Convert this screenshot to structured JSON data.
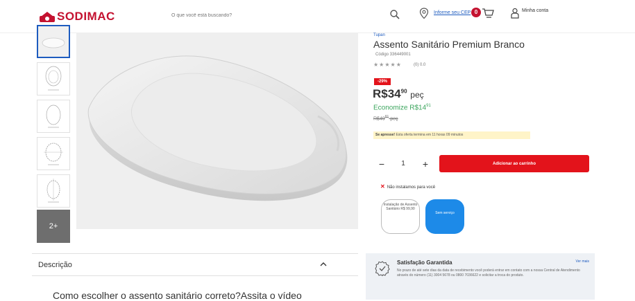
{
  "header": {
    "brand": "SODIMAC",
    "search_placeholder": "O que você está buscando?",
    "cep_link": "Informe seu CEP",
    "cart_count": "0",
    "account_label": "Minha conta"
  },
  "gallery": {
    "more_label": "2+"
  },
  "description": {
    "label": "Descrição",
    "body": "Como escolher o assento sanitário correto?Assita o vídeo"
  },
  "product": {
    "brand": "Tupan",
    "title": "Assento Sanitário Premium Branco",
    "code": "Código 336449001",
    "stars": "★★★★★",
    "rating": "(0) 0.0",
    "discount_badge": "-29%",
    "price": "R$34",
    "price_cents": "90",
    "price_unit": "peç",
    "savings": "Economize R$14",
    "savings_cents": "91",
    "old_price": "R$49",
    "old_price_cents": "81",
    "old_price_unit": "peç",
    "promo_label": "Se apresse!",
    "promo_text": "Esta oferta termina em 11 horas 09 minutos",
    "qty_minus": "−",
    "qty_value": "1",
    "qty_plus": "+",
    "add_to_cart": "Adicionar ao carrinho",
    "no_install": "Não instalamos para você",
    "option_install": "Instalação de Assento Sanitário R$ 99,90",
    "option_none": "Sem serviço"
  },
  "guarantee": {
    "title": "Satisfação Garantida",
    "link": "Ver mais",
    "text": "No prazo de até sete dias da data de recebimento você poderá entrar em contato com a nossa Central de Atendimento através do número (11) 3004 5678 ou 0800 7036622 e solicitar a troca do produto."
  },
  "colors": {
    "brand_red": "#c41230",
    "cta_red": "#e3131b",
    "link_blue": "#1d5bbf",
    "savings_green": "#3ba55d"
  }
}
